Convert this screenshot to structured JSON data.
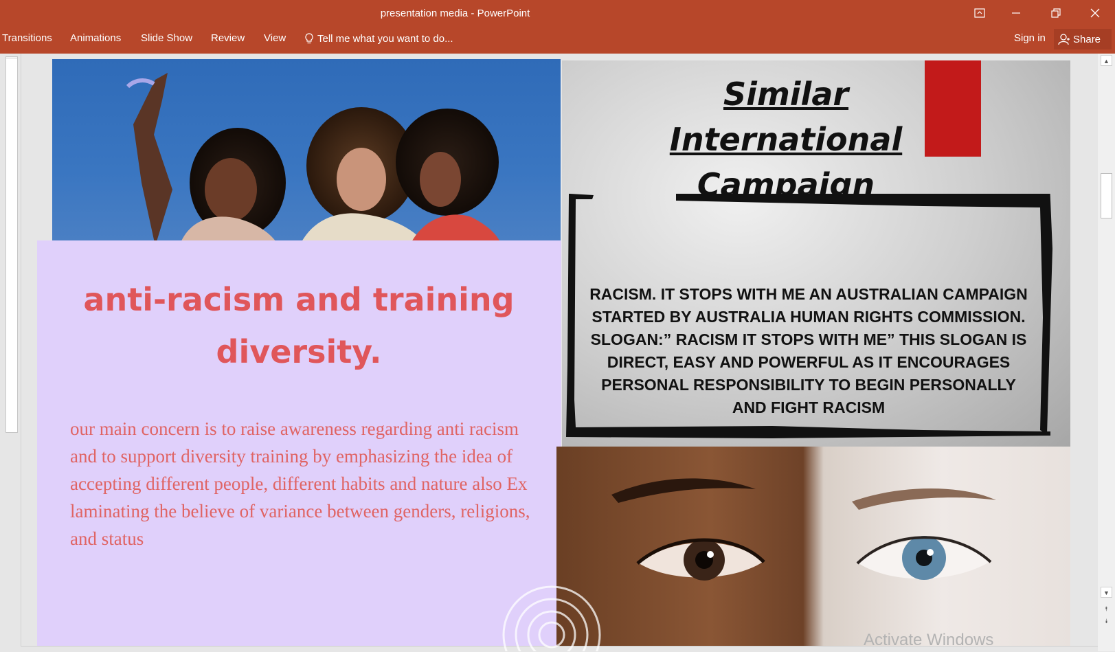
{
  "window": {
    "title": "presentation media - PowerPoint"
  },
  "ribbon": {
    "tabs": [
      "Transitions",
      "Animations",
      "Slide Show",
      "Review",
      "View"
    ],
    "tell_me": "Tell me what you want to do...",
    "sign_in": "Sign in",
    "share": "Share"
  },
  "slide": {
    "heading": "anti-racism and training diversity.",
    "body": "our main concern is to raise awareness regarding anti racism and to support diversity training by emphasizing the idea of accepting different people, different habits and nature also Ex laminating the believe of variance between genders, religions, and status",
    "title": "Similar International Campaign",
    "campaign_text": "RACISM. IT STOPS WITH ME AN AUSTRALIAN CAMPAIGN STARTED BY AUSTRALIA HUMAN RIGHTS COMMISSION. SLOGAN:” RACISM IT STOPS WITH ME” THIS SLOGAN IS DIRECT, EASY AND POWERFUL AS IT ENCOURAGES PERSONAL RESPONSIBILITY TO BEGIN PERSONALLY AND FIGHT RACISM"
  },
  "overlay": {
    "activate_windows": "Activate Windows"
  },
  "colors": {
    "ribbon": "#b7472a",
    "lilac_panel": "#e0d0fb",
    "heading_red": "#e0565a",
    "accent_red_bar": "#c21a1a"
  }
}
